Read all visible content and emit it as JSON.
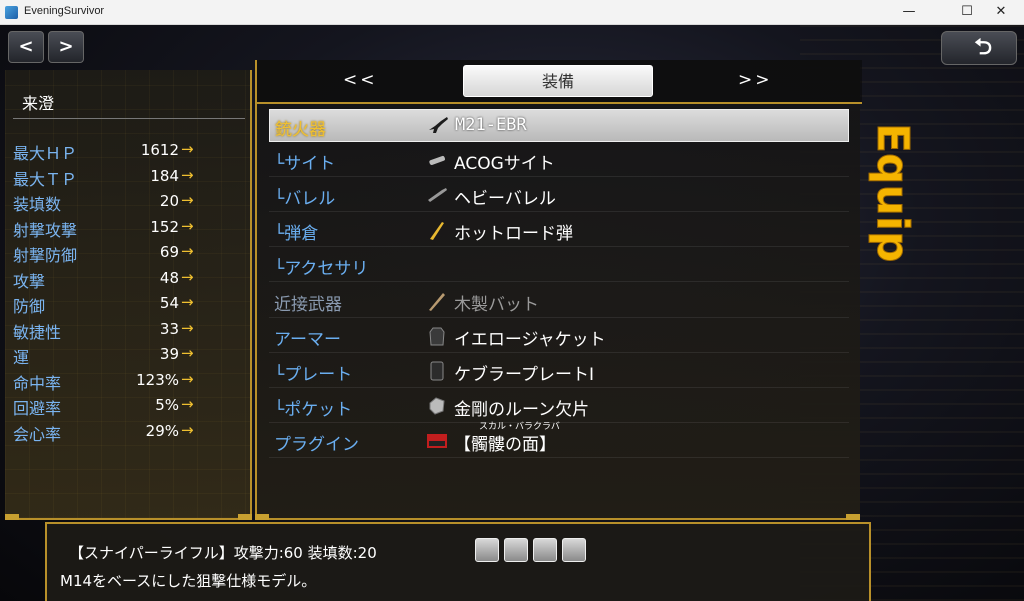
{
  "window": {
    "title": "EveningSurvivor",
    "minimize": "—",
    "maximize": "☐",
    "close": "✕"
  },
  "nav": {
    "prev": "<",
    "next": ">",
    "back": "⮌"
  },
  "character": {
    "name": "来澄"
  },
  "stats": [
    {
      "label": "最大ＨＰ",
      "value": "1612",
      "arrow": "→"
    },
    {
      "label": "最大ＴＰ",
      "value": "184",
      "arrow": "→"
    },
    {
      "label": "装填数",
      "value": "20",
      "arrow": "→"
    },
    {
      "label": "射撃攻撃",
      "value": "152",
      "arrow": "→"
    },
    {
      "label": "射撃防御",
      "value": "69",
      "arrow": "→"
    },
    {
      "label": "攻撃",
      "value": "48",
      "arrow": "→"
    },
    {
      "label": "防御",
      "value": "54",
      "arrow": "→"
    },
    {
      "label": "敏捷性",
      "value": "33",
      "arrow": "→"
    },
    {
      "label": "運",
      "value": "39",
      "arrow": "→"
    },
    {
      "label": "命中率",
      "value": "123%",
      "arrow": "→"
    },
    {
      "label": "回避率",
      "value": "5%",
      "arrow": "→"
    },
    {
      "label": "会心率",
      "value": "29%",
      "arrow": "→"
    }
  ],
  "tabs": {
    "prev": "<<",
    "active": "装備",
    "next": ">>"
  },
  "slots": [
    {
      "label": "銃火器",
      "item": "M21-EBR",
      "icon": "rifle-icon"
    },
    {
      "label": "└サイト",
      "item": "ACOGサイト",
      "icon": "scope-icon"
    },
    {
      "label": "└バレル",
      "item": "ヘビーバレル",
      "icon": "barrel-icon"
    },
    {
      "label": "└弾倉",
      "item": "ホットロード弾",
      "icon": "bullet-icon"
    },
    {
      "label": "└アクセサリ",
      "item": "",
      "icon": ""
    },
    {
      "label": "近接武器",
      "item": "木製バット",
      "icon": "bat-icon"
    },
    {
      "label": "アーマー",
      "item": "イエロージャケット",
      "icon": "jacket-icon"
    },
    {
      "label": "└プレート",
      "item": "ケブラープレートⅠ",
      "icon": "plate-icon"
    },
    {
      "label": "└ポケット",
      "item": "金剛のルーン欠片",
      "icon": "rune-icon"
    },
    {
      "label": "プラグイン",
      "item": "【髑髏の面】",
      "icon": "plugin-icon",
      "ruby": "スカル・バラクラバ"
    }
  ],
  "side_label": "Equip",
  "help": {
    "line1": "【スナイパーライフル】攻撃力:60 装填数:20",
    "line2": "M14をベースにした狙撃仕様モデル。",
    "attr_icons": [
      "gun-attr-icon",
      "ammo-attr-icon",
      "sight-attr-icon",
      "tool-attr-icon"
    ]
  },
  "colors": {
    "accent_gold": "#b8902a",
    "label_blue": "#7ab4f0",
    "selected_gold": "#f0c030",
    "equip_yellow": "#f5b400"
  }
}
